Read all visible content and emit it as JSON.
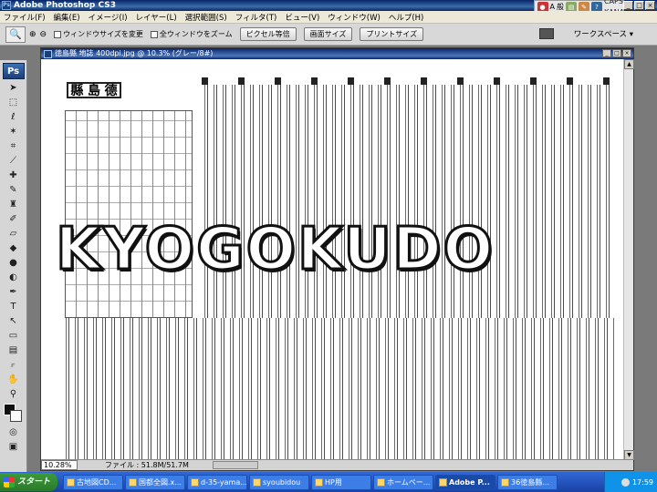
{
  "app": {
    "title": "Adobe Photoshop CS3"
  },
  "menu": [
    "ファイル(F)",
    "編集(E)",
    "イメージ(I)",
    "レイヤー(L)",
    "選択範囲(S)",
    "フィルタ(T)",
    "ビュー(V)",
    "ウィンドウ(W)",
    "ヘルプ(H)"
  ],
  "options": {
    "resize_windows": "ウィンドウサイズを変更",
    "zoom_all": "全ウィンドウをズーム",
    "actual_pixels": "ピクセル等倍",
    "fit_screen": "画面サイズ",
    "print_size": "プリントサイズ",
    "workspace": "ワークスペース ▾"
  },
  "tray": {
    "a": "A",
    "kanji": "般",
    "caps": "CAPS",
    "kana": "KANA"
  },
  "document": {
    "title": "徳島縣 地誌 400dpi.jpg @ 10.3% (グレー/8#)",
    "heading_chars": [
      "縣",
      "島",
      "德"
    ],
    "watermark": "KYOGOKUDO",
    "zoom": "10.28%",
    "filesize": "ファイル : 51.8M/51.7M"
  },
  "taskbar": {
    "start": "スタート",
    "tasks": [
      "古地図CD...",
      "国都全図.x...",
      "d-35-yama...",
      "syoubidou",
      "HP用",
      "ホームペー...",
      "Adobe P...",
      "36徳島縣..."
    ],
    "clock": "17:59"
  }
}
